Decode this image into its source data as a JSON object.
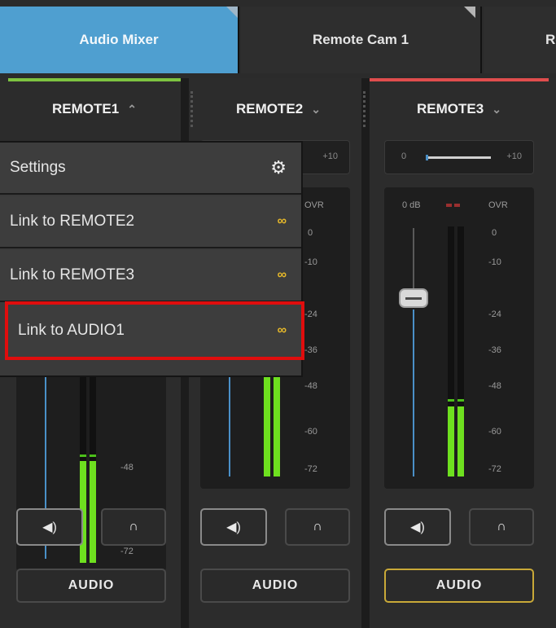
{
  "tabs": [
    {
      "label": "Audio Mixer",
      "active": true
    },
    {
      "label": "Remote Cam 1",
      "active": false
    },
    {
      "label": "Re",
      "active": false
    }
  ],
  "channels": [
    {
      "name": "REMOTE1",
      "chevron": "^",
      "accent": "#7dc341"
    },
    {
      "name": "REMOTE2",
      "chevron": "v",
      "accent": ""
    },
    {
      "name": "REMOTE3",
      "chevron": "v",
      "accent": "#e04d4d"
    }
  ],
  "gain": {
    "min": "0",
    "max": "+10"
  },
  "meter": {
    "db_readout": "0 dB",
    "over_label": "OVR",
    "scale": [
      "0",
      "-10",
      "-24",
      "-36",
      "-48",
      "-60",
      "-72"
    ]
  },
  "levels": {
    "remote1_fill": 0.52,
    "remote2_fill": 0.58,
    "remote3_fill": 0.28
  },
  "buttons": {
    "audio_label": "AUDIO",
    "speaker_icon": "speaker-icon",
    "headphones_icon": "headphones-icon"
  },
  "menu": {
    "settings": "Settings",
    "items": [
      {
        "label": "Link to REMOTE2"
      },
      {
        "label": "Link to REMOTE3"
      },
      {
        "label": "Link to AUDIO1"
      }
    ]
  },
  "colors": {
    "accent_blue": "#4f9fd0",
    "highlight_red": "#e00d0d",
    "link_gold": "#e7b92a",
    "meter_green": "#6ee01f",
    "selected_gold": "#c9a938"
  }
}
